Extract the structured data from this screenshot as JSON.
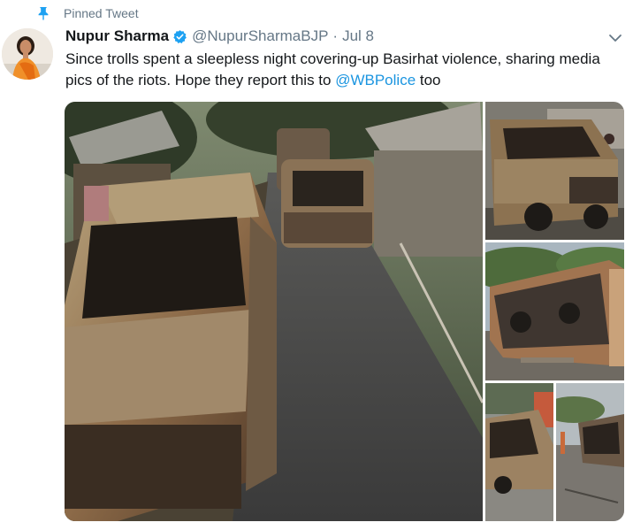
{
  "pinned": {
    "label": "Pinned Tweet",
    "icon": "pin-icon",
    "color": "#1da1f2"
  },
  "tweet": {
    "display_name": "Nupur Sharma",
    "verified_icon": "verified-badge-icon",
    "handle": "@NupurSharmaBJP",
    "separator": "·",
    "date": "Jul 8",
    "text_before": "Since trolls spent a sleepless night covering-up Basirhat violence, sharing media pics of the riots. Hope they report this to ",
    "mention": "@WBPolice",
    "text_after": " too",
    "menu_icon": "chevron-down-icon"
  },
  "media": {
    "count": 4
  },
  "colors": {
    "accent": "#1da1f2",
    "link": "#1b95e0",
    "secondary_text": "#657786",
    "primary_text": "#14171a"
  }
}
